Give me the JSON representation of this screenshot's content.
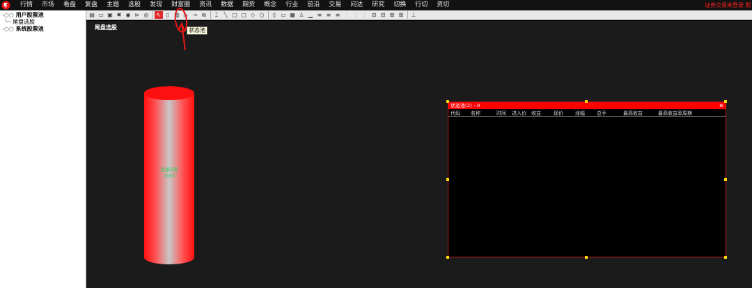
{
  "menu": {
    "items": [
      "行情",
      "市场",
      "看盘",
      "复盘",
      "主题",
      "选股",
      "发现",
      "财富圈",
      "资讯",
      "数据",
      "期货",
      "概念",
      "行业",
      "前沿",
      "交易",
      "问达",
      "研究",
      "切换",
      "行切",
      "资切"
    ],
    "login_status": "证券交易未登录  期"
  },
  "tree": {
    "user_pool": "用户股票池",
    "user_pool_child": "尾盘选股",
    "system_pool": "系统股票池"
  },
  "canvas": {
    "title": "尾盘选股",
    "tooltip": "状态池"
  },
  "cylinder": {
    "line1": "全部A股",
    "line2": "(0/0)"
  },
  "pool": {
    "title": "状态池(2) - 0",
    "pin": "⊕",
    "columns": [
      "代码",
      "名称",
      "时间",
      "进入价",
      "收益",
      "现价",
      "涨幅",
      "总手",
      "最高收益",
      "最高收益率周期"
    ]
  },
  "colors": {
    "accent": "#ff0000",
    "canvas_bg": "#1b1b1b",
    "handle": "#ffdc00"
  }
}
